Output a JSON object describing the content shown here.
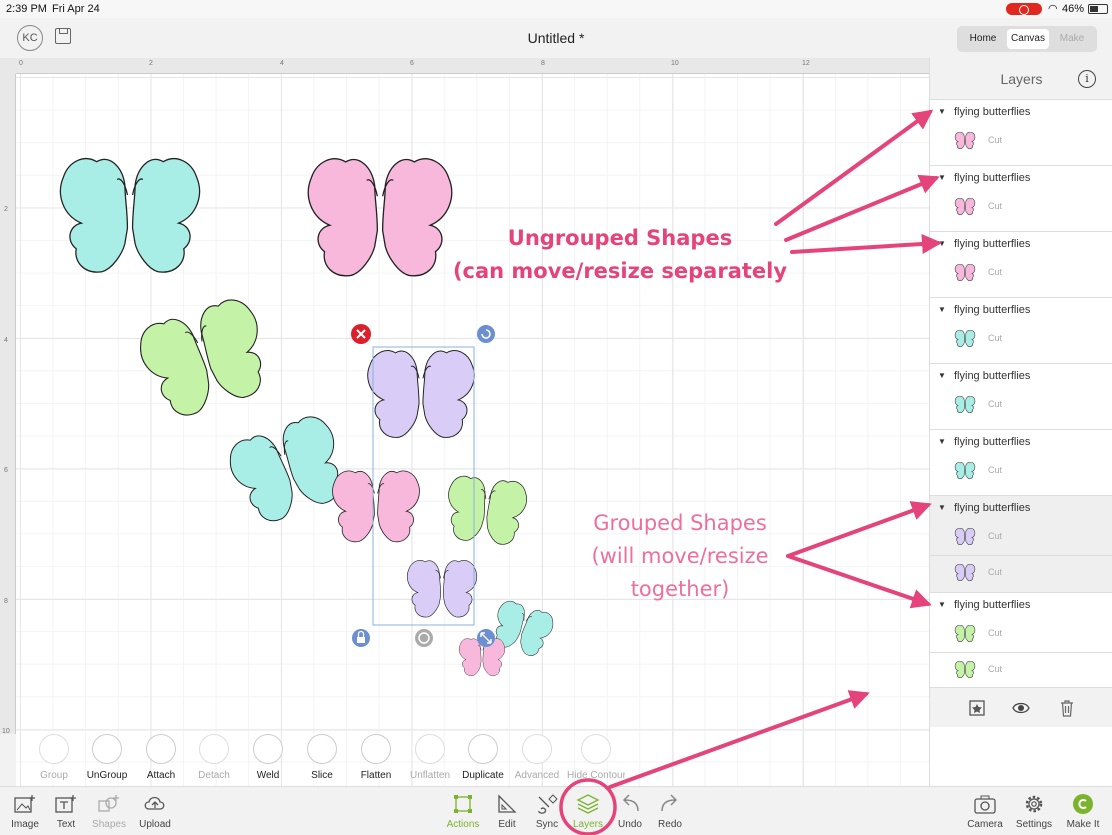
{
  "status_bar": {
    "time": "2:39 PM",
    "date": "Fri Apr 24",
    "battery": "46%"
  },
  "header": {
    "avatar": "KC",
    "title": "Untitled *",
    "tabs": [
      {
        "label": "Home"
      },
      {
        "label": "Canvas"
      },
      {
        "label": "Make"
      }
    ]
  },
  "rulers": {
    "top": [
      "0",
      "2",
      "4",
      "6",
      "8",
      "10",
      "12"
    ],
    "left": [
      "2",
      "4",
      "6",
      "8",
      "10"
    ]
  },
  "layers_panel": {
    "title": "Layers",
    "groups": [
      {
        "name": "flying butterflies",
        "items": [
          {
            "label": "Cut",
            "color": "#f7b8dc"
          }
        ]
      },
      {
        "name": "flying butterflies",
        "items": [
          {
            "label": "Cut",
            "color": "#f7b8dc"
          }
        ]
      },
      {
        "name": "flying butterflies",
        "items": [
          {
            "label": "Cut",
            "color": "#f7b8dc"
          }
        ]
      },
      {
        "name": "flying butterflies",
        "items": [
          {
            "label": "Cut",
            "color": "#a9eee6"
          }
        ]
      },
      {
        "name": "flying butterflies",
        "items": [
          {
            "label": "Cut",
            "color": "#a9eee6"
          }
        ]
      },
      {
        "name": "flying butterflies",
        "items": [
          {
            "label": "Cut",
            "color": "#a9eee6"
          }
        ]
      },
      {
        "name": "flying butterflies",
        "items": [
          {
            "label": "Cut",
            "color": "#d9cdf7"
          },
          {
            "label": "Cut",
            "color": "#d9cdf7"
          }
        ]
      },
      {
        "name": "flying butterflies",
        "items": [
          {
            "label": "Cut",
            "color": "#c4f3a8"
          },
          {
            "label": "Cut",
            "color": "#c4f3a8"
          }
        ]
      }
    ]
  },
  "actions": [
    {
      "label": "Group",
      "enabled": false
    },
    {
      "label": "UnGroup",
      "enabled": true
    },
    {
      "label": "Attach",
      "enabled": true
    },
    {
      "label": "Detach",
      "enabled": false
    },
    {
      "label": "Weld",
      "enabled": true
    },
    {
      "label": "Slice",
      "enabled": true
    },
    {
      "label": "Flatten",
      "enabled": true
    },
    {
      "label": "Unflatten",
      "enabled": false
    },
    {
      "label": "Duplicate",
      "enabled": true
    },
    {
      "label": "Advanced",
      "enabled": false
    },
    {
      "label": "Hide Contour",
      "enabled": false
    }
  ],
  "toolbar": {
    "image": "Image",
    "text": "Text",
    "shapes": "Shapes",
    "upload": "Upload",
    "actions": "Actions",
    "edit": "Edit",
    "sync": "Sync",
    "layers": "Layers",
    "undo": "Undo",
    "redo": "Redo",
    "camera": "Camera",
    "settings": "Settings",
    "make_it": "Make It"
  },
  "annotations": {
    "ungrouped_line1": "Ungrouped Shapes",
    "ungrouped_line2": "(can move/resize separately",
    "grouped_line1": "Grouped Shapes",
    "grouped_line2": "(will move/resize",
    "grouped_line3": "together)"
  },
  "colors": {
    "pink": "#f7b8dc",
    "teal": "#a9eee6",
    "green": "#c4f3a8",
    "lavender": "#d9cdf7",
    "annotation": "#e4447a",
    "accent_green": "#7bb32e",
    "delete_red": "#d9202b",
    "handle_blue": "#6b8fd0"
  }
}
